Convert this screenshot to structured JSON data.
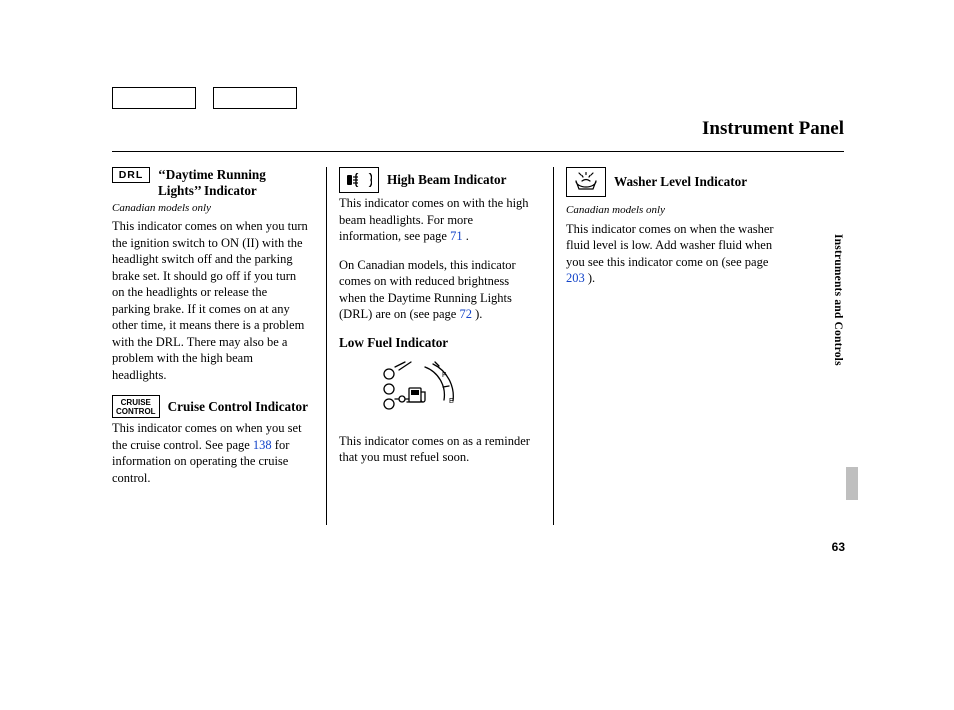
{
  "header": {
    "title": "Instrument Panel"
  },
  "sidetab": "Instruments and Controls",
  "pagenum": "63",
  "col1": {
    "drl": {
      "icon_text": "DRL",
      "heading": "‘‘Daytime Running Lights’’ Indicator",
      "note": "Canadian models only",
      "body": "This indicator comes on when you turn the ignition switch to ON (II) with the headlight switch off and the parking brake set. It should go off if you turn on the headlights or release the parking brake. If it comes on at any other time, it means there is a problem with the DRL. There may also be a problem with the high beam headlights."
    },
    "cruise": {
      "icon_line1": "CRUISE",
      "icon_line2": "CONTROL",
      "heading": "Cruise Control Indicator",
      "body_a": "This indicator comes on when you set the cruise control. See page ",
      "link": "138",
      "body_b": " for information on operating the cruise control."
    }
  },
  "col2": {
    "highbeam": {
      "heading": "High Beam Indicator",
      "body_a": "This indicator comes on with the high beam headlights. For more information, see page ",
      "link": "71",
      "body_b": " ."
    },
    "highbeam2": {
      "body_a": "On Canadian models, this indicator comes on with reduced brightness when the Daytime Running Lights (DRL) are on (see page ",
      "link": "72",
      "body_b": " )."
    },
    "lowfuel": {
      "heading": "Low Fuel Indicator",
      "body": "This indicator comes on as a reminder that you must refuel soon."
    }
  },
  "col3": {
    "washer": {
      "heading": "Washer Level Indicator",
      "note": "Canadian models only",
      "body_a": "This indicator comes on when the washer fluid level is low. Add washer fluid when you see this indicator come on (see page ",
      "link": "203",
      "body_b": " )."
    }
  }
}
